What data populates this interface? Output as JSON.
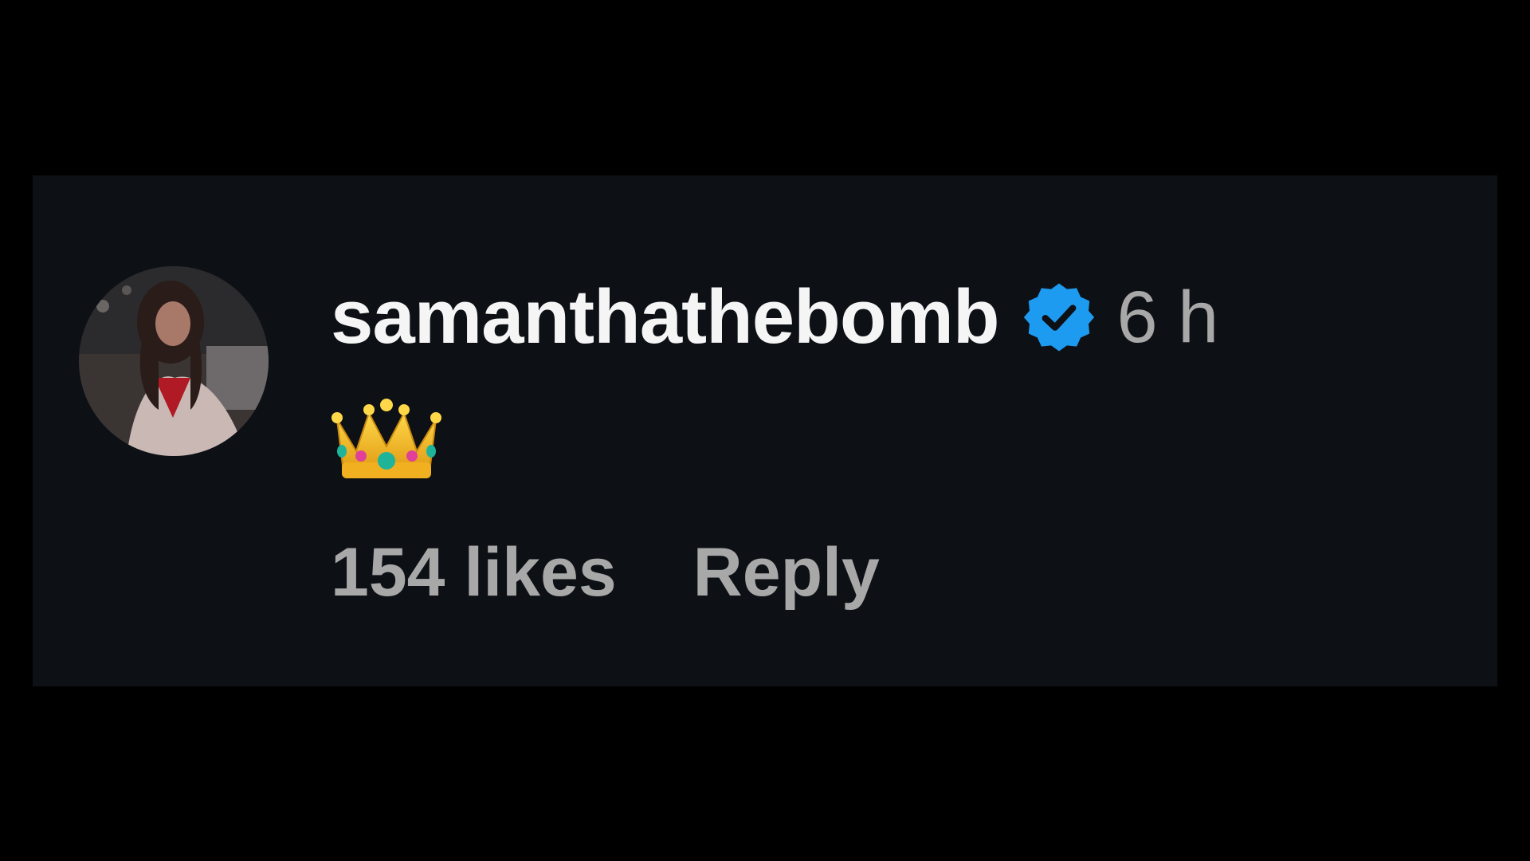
{
  "comment": {
    "username": "samanthathebomb",
    "verified": true,
    "timestamp": "6 h",
    "body_emoji": "crown-emoji",
    "likes_label": "154 likes",
    "reply_label": "Reply"
  },
  "colors": {
    "card_background": "#0d1015",
    "page_background": "#000000",
    "username_text": "#f5f5f5",
    "secondary_text": "#a8a8a8",
    "verified_badge": "#1d9bf0"
  },
  "icons": {
    "avatar": "avatar",
    "verified": "verified-badge-icon",
    "body": "crown-icon"
  }
}
